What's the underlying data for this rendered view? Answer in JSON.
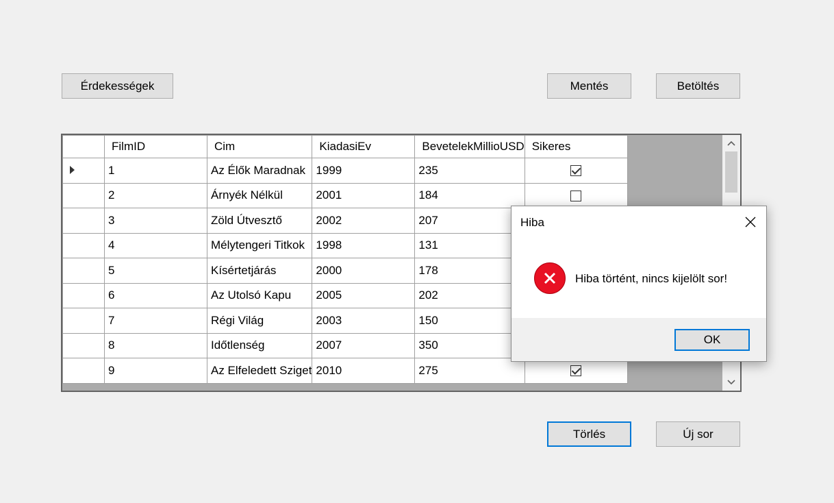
{
  "toolbar": {
    "interesting_label": "Érdekességek",
    "save_label": "Mentés",
    "load_label": "Betöltés"
  },
  "bottom": {
    "delete_label": "Törlés",
    "new_row_label": "Új sor"
  },
  "grid": {
    "columns": [
      "FilmID",
      "Cim",
      "KiadasiEv",
      "BevetelekMillioUSD",
      "Sikeres"
    ],
    "rows": [
      {
        "id": "1",
        "cim": "Az Élők Maradnak",
        "ev": "1999",
        "bevetel": "235",
        "sikeres": true,
        "current": true
      },
      {
        "id": "2",
        "cim": "Árnyék Nélkül",
        "ev": "2001",
        "bevetel": "184",
        "sikeres": false
      },
      {
        "id": "3",
        "cim": "Zöld Útvesztő",
        "ev": "2002",
        "bevetel": "207",
        "sikeres": null
      },
      {
        "id": "4",
        "cim": "Mélytengeri Titkok",
        "ev": "1998",
        "bevetel": "131",
        "sikeres": null
      },
      {
        "id": "5",
        "cim": "Kísértetjárás",
        "ev": "2000",
        "bevetel": "178",
        "sikeres": null
      },
      {
        "id": "6",
        "cim": "Az Utolsó Kapu",
        "ev": "2005",
        "bevetel": "202",
        "sikeres": null
      },
      {
        "id": "7",
        "cim": "Régi Világ",
        "ev": "2003",
        "bevetel": "150",
        "sikeres": null
      },
      {
        "id": "8",
        "cim": "Időtlenség",
        "ev": "2007",
        "bevetel": "350",
        "sikeres": null
      },
      {
        "id": "9",
        "cim": "Az Elfeledett Sziget",
        "ev": "2010",
        "bevetel": "275",
        "sikeres": true
      }
    ]
  },
  "dialog": {
    "title": "Hiba",
    "message": "Hiba történt, nincs kijelölt sor!",
    "ok_label": "OK",
    "icon": "error-icon"
  },
  "colors": {
    "window_bg": "#f0f0f0",
    "button_bg": "#e1e1e1",
    "focus_border": "#0078d7",
    "error_red": "#e81123",
    "grid_empty_bg": "#ababab"
  }
}
